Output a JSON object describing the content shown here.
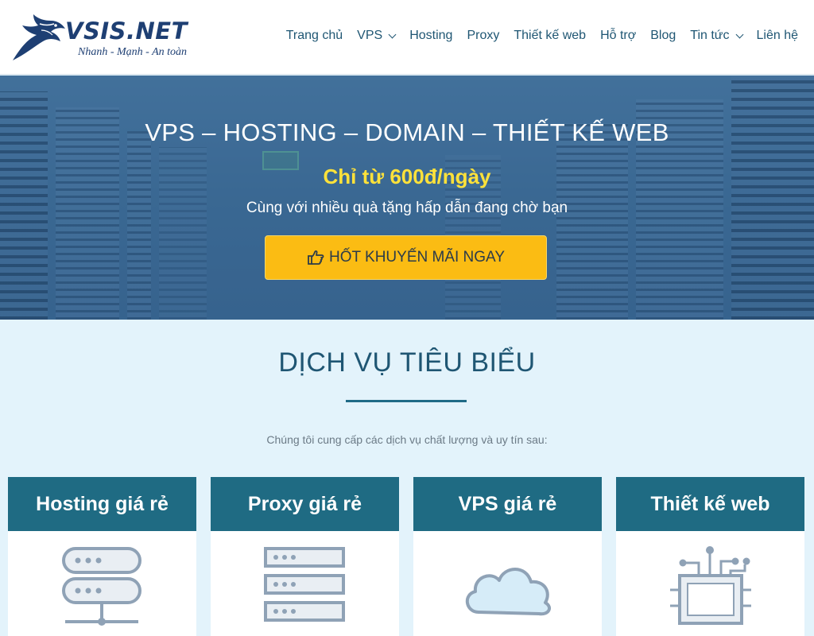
{
  "brand": {
    "name": "VSIS.NET",
    "slogan": "Nhanh - Mạnh - An toàn"
  },
  "nav": {
    "items": [
      {
        "label": "Trang chủ",
        "dropdown": false
      },
      {
        "label": "VPS",
        "dropdown": true
      },
      {
        "label": "Hosting",
        "dropdown": false
      },
      {
        "label": "Proxy",
        "dropdown": false
      },
      {
        "label": "Thiết kế web",
        "dropdown": false
      },
      {
        "label": "Hỗ trợ",
        "dropdown": false
      },
      {
        "label": "Blog",
        "dropdown": false
      },
      {
        "label": "Tin tức",
        "dropdown": true
      },
      {
        "label": "Liên hệ",
        "dropdown": false
      }
    ]
  },
  "hero": {
    "title": "VPS – HOSTING – DOMAIN – THIẾT KẾ WEB",
    "price": "Chỉ từ 600đ/ngày",
    "subtitle": "Cùng với nhiều quà tặng hấp dẫn đang chờ bạn",
    "button_label": "HỐT KHUYẾN MÃI NGAY",
    "button_icon": "hand-pointer-icon"
  },
  "services": {
    "title": "DỊCH VỤ TIÊU BIỂU",
    "description": "Chúng tôi cung cấp các dịch vụ chất lượng và uy tín sau:",
    "cards": [
      {
        "title": "Hosting giá rẻ",
        "icon": "server-network-icon"
      },
      {
        "title": "Proxy giá rẻ",
        "icon": "server-stack-icon"
      },
      {
        "title": "VPS giá rẻ",
        "icon": "cloud-icon"
      },
      {
        "title": "Thiết kế web",
        "icon": "circuit-monitor-icon"
      }
    ]
  },
  "colors": {
    "brand": "#1e3f73",
    "nav_text": "#1f5673",
    "card_header": "#1f6b83",
    "cta": "#fbbc13",
    "price": "#ffe23a",
    "section_bg": "#e3f3fb"
  }
}
